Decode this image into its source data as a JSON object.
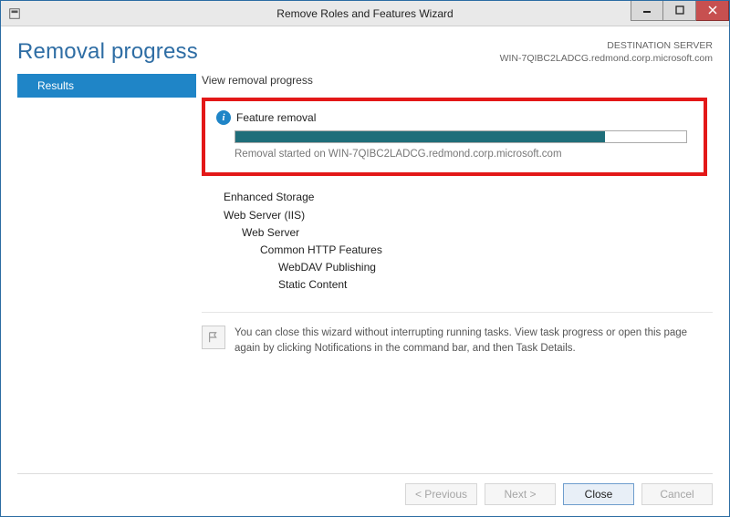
{
  "window": {
    "title": "Remove Roles and Features Wizard"
  },
  "header": {
    "page_title": "Removal progress",
    "dest_label": "DESTINATION SERVER",
    "dest_value": "WIN-7QIBC2LADCG.redmond.corp.microsoft.com"
  },
  "sidebar": {
    "step": "Results"
  },
  "main": {
    "section_label": "View removal progress",
    "feature_removal": {
      "title": "Feature removal",
      "percent": 82,
      "status": "Removal started on WIN-7QIBC2LADCG.redmond.corp.microsoft.com"
    },
    "tree": {
      "l0a": "Enhanced Storage",
      "l0b": "Web Server (IIS)",
      "l1a": "Web Server",
      "l2a": "Common HTTP Features",
      "l3a": "WebDAV Publishing",
      "l3b": "Static Content"
    },
    "hint": "You can close this wizard without interrupting running tasks. View task progress or open this page again by clicking Notifications in the command bar, and then Task Details."
  },
  "footer": {
    "previous": "< Previous",
    "next": "Next >",
    "close": "Close",
    "cancel": "Cancel"
  }
}
